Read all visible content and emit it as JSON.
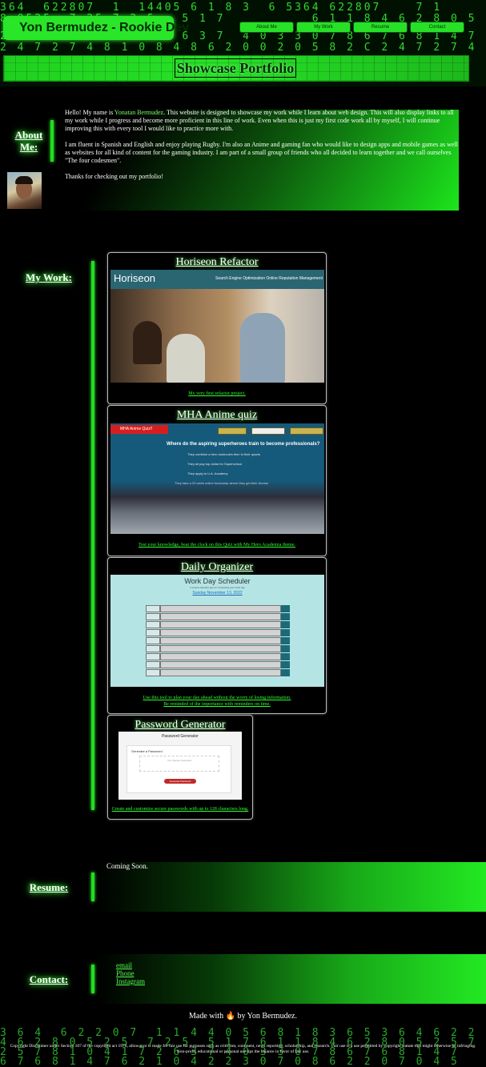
{
  "header": {
    "brand": "Yon Bermudez - Rookie Dev",
    "nav": [
      "About Me",
      "My Work",
      "Resume",
      "Contact"
    ],
    "title": "Showcase Portfolio",
    "matrix_rows": [
      "364  622807  1  14405 6 1 8 3  6 5364 622807    7 1",
      "8 0525  7 25 7 2 5   5 1 7          6 1 1 8 4 6 2 8 0 5 2 5",
      "2 5 7 8  1 0 4 1 7 2 6 3 7  4 0 3 3 0 7 8 6 7 6 8 1 4 7 6 2 8 1",
      "2 4 7 2 7 4 8 1 0 8 4 8 6 2 0 0 2 0 5 8 2 C 2 4 7 2 7 4 8 1 0 8"
    ]
  },
  "about": {
    "heading": "About Me:",
    "p1_before": "Hello! My name is ",
    "p1_name": "Yonatan Bermudez",
    "p1_after": ". This website is designed to showcase my work while I learn about web design. This will also display links to all my work while I progress and become more proficient in this line of work. Even when this is just my first code work all by myself, I will continue improving this with every tool I would like to practice more with.",
    "p2": "I am fluent in Spanish and English and enjoy playing Rugby. I'm also an Anime and gaming fan who would like to design apps and mobile games as well as websites for all kind of content for the gaming industry. I am part of a small group of friends who all decided to learn together and we call ourselves \"The four codesmen\".",
    "p3": "Thanks for checking out my portfolio!"
  },
  "work": {
    "heading": "My Work:",
    "projects": [
      {
        "title": "Horiseon Refactor",
        "caption": "My very first refactor project.",
        "shot": {
          "logo": "Horiseon",
          "nav": "Search Engine Optimization     Online Reputation Management"
        }
      },
      {
        "title": "MHA Anime quiz",
        "caption": "Test your knowledge, beat the clock on this Quiz with My Hero Academia theme.",
        "shot": {
          "badge": "MHA Anime Quiz!!",
          "question": "Where do the aspiring superheroes train to become professionals?",
          "answers": [
            "They combine a hero molecules then in their quarts",
            "They all pay top dollar for Superschool",
            "They apply to U.A. Academy",
            "They take a 20 week online bootcamp where they get their license"
          ]
        }
      },
      {
        "title": "Daily Organizer",
        "caption_line1": "Use this tool to plan your day ahead without the worry of losing information.",
        "caption_line2": "Be reminded of the importance with reminders on time.",
        "shot": {
          "title": "Work Day Scheduler",
          "subtitle": "A simple calendar app for scheduling your work day",
          "date": "Sunday November 13, 2022"
        }
      },
      {
        "title": "Password Generator",
        "caption": "Create and customize secure passwords with up to 128 characters long.",
        "shot": {
          "title": "Password Generator",
          "subtitle": "Generate a Password",
          "placeholder": "Your Secure Password",
          "button": "Generate Password"
        }
      }
    ]
  },
  "resume": {
    "heading": "Resume:",
    "text": "Coming Soon."
  },
  "contact": {
    "heading": "Contact:",
    "links": [
      "email",
      "Phone",
      "Instagram"
    ]
  },
  "footer": {
    "made_before": "Made with",
    "made_after": "by Yon Bermudez.",
    "icon": "fire-icon",
    "copyright": "Copyright Disclaimer under Section 107 of the copyright act 1976, allowance is made for fair use for purposes such as criticism, comment, news reporting, scholarship, and research. Fair use is a use permitted by copyright statute that might otherwise be infringing. Non-profit, educational or personal use tips the balance in favor of fair use.",
    "matrix_rows": [
      "3 6 4  6 2 2 0 7  1 1 4 4 0 5 6 8 1 8 3 6 5 3 6 4 6 2 2 0 7",
      "4 6 2 8 0 5 2 5  7 2 5  5 1 7 6 1 1 8 4 6 2 8 0 5 2 5 7",
      "2 5 7 8 1 0 4 1 7 2 6 3 7 4 0 3 3 0 7 8 6 7 6 8 1 4 7",
      "6 7 6 8 1 4 7 6 2 1 0 4 2 2 3 0 7 0 8 6 2 2 0 7 0 4 5"
    ]
  },
  "colors": {
    "accent": "#22dd22",
    "background": "#000000",
    "link": "#33ff33"
  }
}
